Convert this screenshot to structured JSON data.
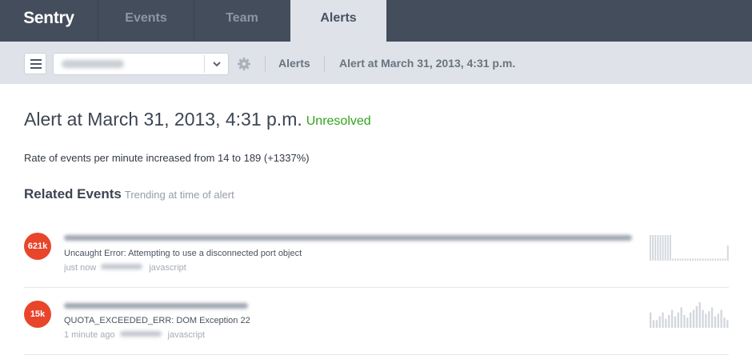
{
  "nav": {
    "logo": "Sentry",
    "tabs": [
      {
        "label": "Events"
      },
      {
        "label": "Team"
      },
      {
        "label": "Alerts"
      }
    ],
    "active_tab": "Alerts"
  },
  "subnav": {
    "breadcrumbs": [
      "Alerts",
      "Alert at March 31, 2013, 4:31 p.m."
    ]
  },
  "alert": {
    "title": "Alert at March 31, 2013, 4:31 p.m.",
    "status": "Unresolved",
    "status_color": "#31a31b",
    "description": "Rate of events per minute increased from 14 to 189 (+1337%)"
  },
  "related": {
    "heading": "Related Events",
    "subheading": "Trending at time of alert",
    "events": [
      {
        "count": "621k",
        "message": "Uncaught Error: Attempting to use a disconnected port object",
        "time": "just now",
        "platform": "javascript",
        "spark": [
          1,
          1,
          1,
          1,
          1,
          1,
          1,
          1,
          1,
          0.08,
          0.08,
          0.08,
          0.08,
          0.08,
          0.08,
          0.08,
          0.08,
          0.08,
          0.08,
          0.08,
          0.08,
          0.08,
          0.08,
          0.08,
          0.08,
          0.08,
          0.08,
          0.08,
          0.08,
          0.08,
          0.08,
          0.6
        ]
      },
      {
        "count": "15k",
        "message": "QUOTA_EXCEEDED_ERR: DOM Exception 22",
        "time": "1 minute ago",
        "platform": "javascript",
        "spark": [
          0.6,
          0.3,
          0.3,
          0.45,
          0.6,
          0.35,
          0.5,
          0.7,
          0.45,
          0.6,
          0.8,
          0.5,
          0.4,
          0.6,
          0.7,
          0.85,
          1,
          0.7,
          0.55,
          0.65,
          0.8,
          0.45,
          0.55,
          0.7,
          0.4,
          0.3
        ]
      }
    ]
  },
  "colors": {
    "nav_bg": "#434d5c",
    "subnav_bg": "#dfe3e9",
    "badge": "#e8452b",
    "spark_bar": "#d3d7dd"
  }
}
